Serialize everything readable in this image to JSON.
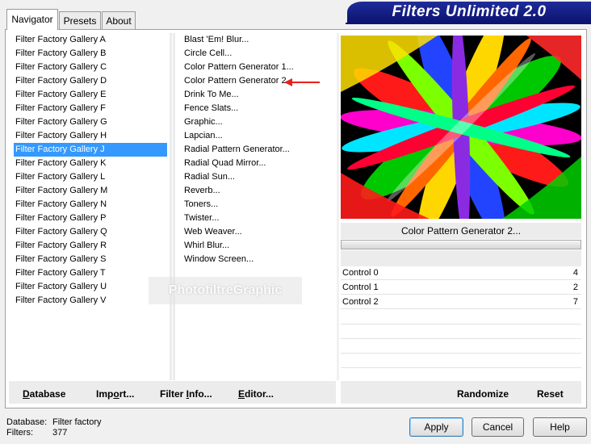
{
  "tabs": [
    {
      "label": "Navigator",
      "active": true
    },
    {
      "label": "Presets",
      "active": false
    },
    {
      "label": "About",
      "active": false
    }
  ],
  "banner": {
    "title": "Filters Unlimited 2.0"
  },
  "categories": [
    "Filter Factory Gallery A",
    "Filter Factory Gallery B",
    "Filter Factory Gallery C",
    "Filter Factory Gallery D",
    "Filter Factory Gallery E",
    "Filter Factory Gallery F",
    "Filter Factory Gallery G",
    "Filter Factory Gallery H",
    "Filter Factory Gallery J",
    "Filter Factory Gallery K",
    "Filter Factory Gallery L",
    "Filter Factory Gallery M",
    "Filter Factory Gallery N",
    "Filter Factory Gallery P",
    "Filter Factory Gallery Q",
    "Filter Factory Gallery R",
    "Filter Factory Gallery S",
    "Filter Factory Gallery T",
    "Filter Factory Gallery U",
    "Filter Factory Gallery V"
  ],
  "selected_category": "Filter Factory Gallery J",
  "filters": [
    "Blast 'Em! Blur...",
    "Circle Cell...",
    "Color Pattern Generator 1...",
    "Color Pattern Generator 2...",
    "Drink To Me...",
    "Fence Slats...",
    "Graphic...",
    "Lapcian...",
    "Radial Pattern Generator...",
    "Radial Quad Mirror...",
    "Radial Sun...",
    "Reverb...",
    "Toners...",
    "Twister...",
    "Web Weaver...",
    "Whirl Blur...",
    "Window Screen..."
  ],
  "selected_filter": "Color Pattern Generator 2...",
  "watermark": "PhotofiltreGraphic",
  "preview": {
    "filter_name": "Color Pattern Generator 2...",
    "progress": 0
  },
  "controls": [
    {
      "label": "Control 0",
      "value": "4"
    },
    {
      "label": "Control 1",
      "value": "2"
    },
    {
      "label": "Control 2",
      "value": "7"
    }
  ],
  "left_buttons": {
    "database": {
      "u": "D",
      "rest": "atabase"
    },
    "import": {
      "pre": "Imp",
      "u": "o",
      "rest": "rt..."
    },
    "filter_info": {
      "pre": "Filter ",
      "u": "I",
      "rest": "nfo..."
    },
    "editor": {
      "u": "E",
      "rest": "ditor..."
    }
  },
  "right_buttons": {
    "randomize": "Randomize",
    "reset": "Reset"
  },
  "status": {
    "database_label": "Database:",
    "database_value": "Filter factory",
    "filters_label": "Filters:",
    "filters_value": "377"
  },
  "dialog_buttons": {
    "apply": "Apply",
    "cancel": "Cancel",
    "help": "Help"
  },
  "colors": {
    "selection": "#3399ff",
    "banner": "#0c1470",
    "arrow": "#e8201c"
  }
}
